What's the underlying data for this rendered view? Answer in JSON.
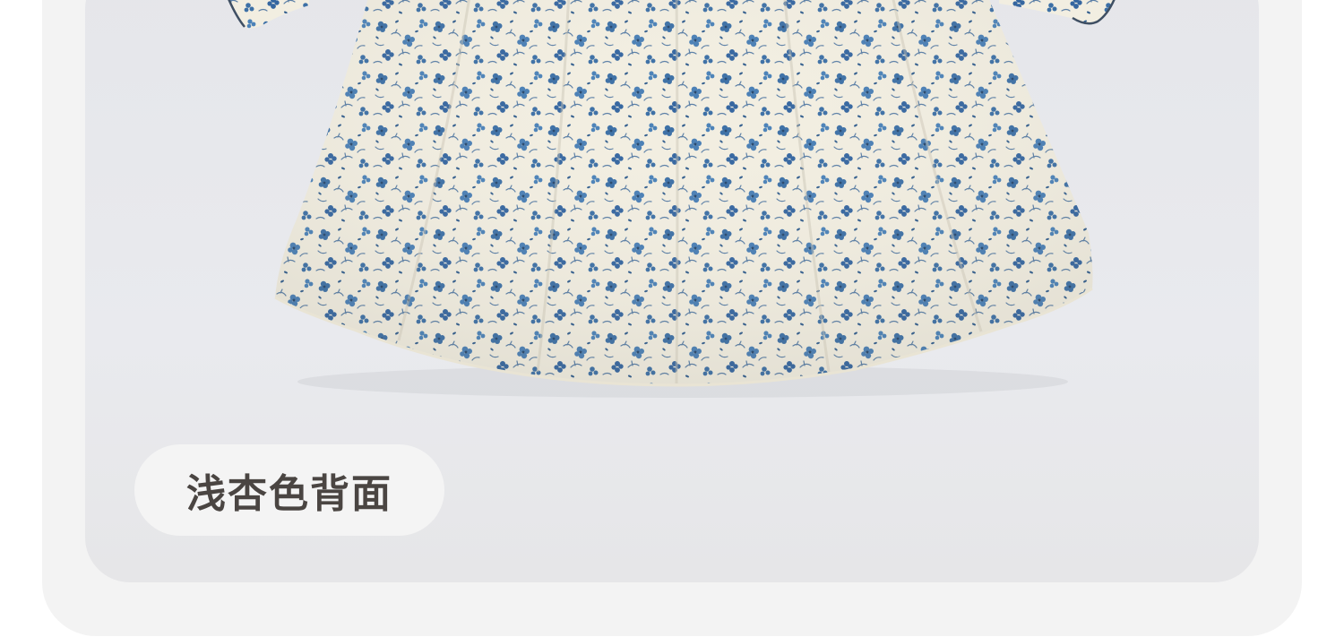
{
  "product_view": {
    "color_label": "浅杏色背面",
    "fabric_print": "blue-floral-print",
    "colors": {
      "fabric_base": "#f3efe2",
      "print_blue": "#3f73a8",
      "print_dark": "#2d5279",
      "backdrop": "#e7e8ec",
      "card": "#f3f3f3",
      "label_text": "#4a4542"
    }
  }
}
